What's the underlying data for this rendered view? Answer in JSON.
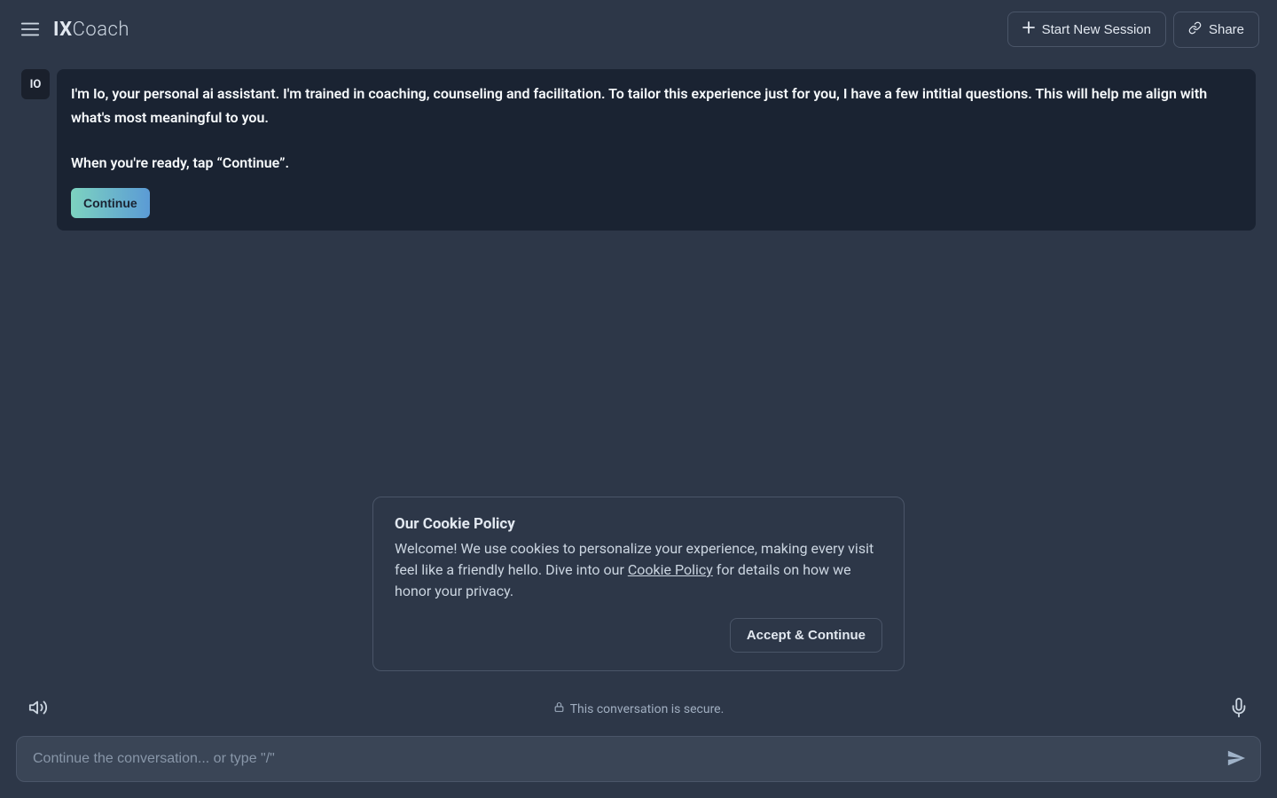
{
  "header": {
    "logo_prefix": "IX",
    "logo_suffix": "Coach",
    "start_session_label": "Start New Session",
    "share_label": "Share"
  },
  "chat": {
    "avatar_label": "IO",
    "message_paragraph_1": "I'm Io, your personal ai assistant. I'm trained in coaching, counseling and facilitation. To tailor this experience just for you, I have a few intitial questions. This will help me align with what's most meaningful to you.",
    "message_paragraph_2": "When you're ready, tap “Continue”.",
    "continue_label": "Continue"
  },
  "cookie": {
    "title": "Our Cookie Policy",
    "text_before_link": "Welcome! We use cookies to personalize your experience, making every visit feel like a friendly hello. Dive into our ",
    "link_text": "Cookie Policy",
    "text_after_link": " for details on how we honor your privacy.",
    "accept_label": "Accept & Continue"
  },
  "footer": {
    "security_text": "This conversation is secure.",
    "input_placeholder": "Continue the conversation... or type \"/\""
  }
}
